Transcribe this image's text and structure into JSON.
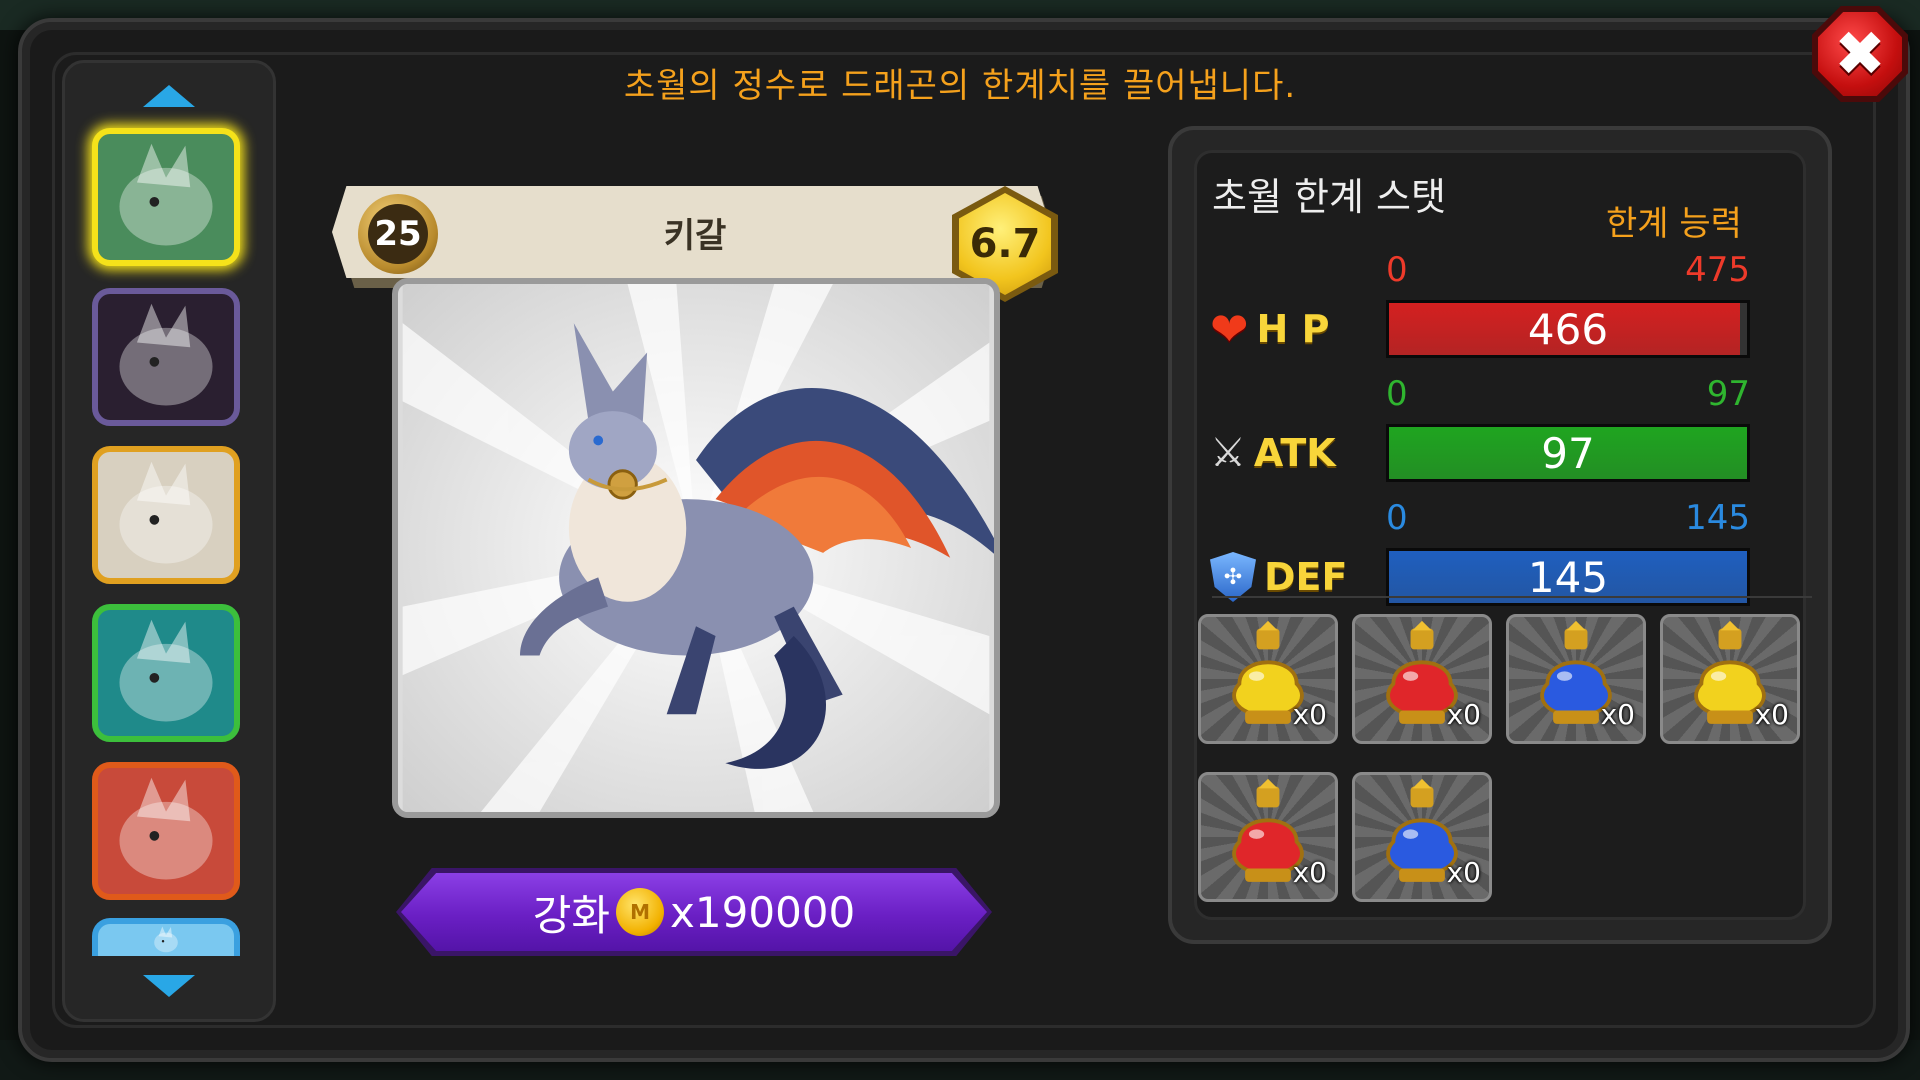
{
  "instruction": "초월의 정수로 드래곤의 한계치를 끌어냅니다.",
  "close_icon_glyph": "✖",
  "dragon_list": {
    "items": [
      {
        "name": "dragon-thumb-kigal",
        "border": "#f5e21a",
        "color": "#4a8c5c"
      },
      {
        "name": "dragon-thumb-dark",
        "border": "#6a5a9a",
        "color": "#2a1f30"
      },
      {
        "name": "dragon-thumb-white-gold",
        "border": "#e0a020",
        "color": "#d8d0c0"
      },
      {
        "name": "dragon-thumb-cyan",
        "border": "#3cbf3c",
        "color": "#1f8a8a"
      },
      {
        "name": "dragon-thumb-red",
        "border": "#e05a1a",
        "color": "#c84a3a"
      },
      {
        "name": "dragon-thumb-ice",
        "border": "#3aa0e0",
        "color": "#7ac8f0"
      }
    ]
  },
  "dragon": {
    "level": "25",
    "name": "키갈",
    "grade": "6.7"
  },
  "enhance": {
    "label": "강화",
    "coin_glyph": "M",
    "cost": "x190000"
  },
  "stats": {
    "title": "초월 한계 스탯",
    "limit_label": "한계 능력",
    "items": [
      {
        "label": "H P",
        "icon": "heart-icon",
        "glyph": "❤",
        "min": "0",
        "max": "475",
        "value": "466",
        "fill_fraction": 0.981,
        "color": "#d42020",
        "range_color": "#ee3a2a"
      },
      {
        "label": "ATK",
        "icon": "swords-icon",
        "glyph": "⚔",
        "min": "0",
        "max": "97",
        "value": "97",
        "fill_fraction": 1.0,
        "color": "#1fa520",
        "range_color": "#2fb52f"
      },
      {
        "label": "DEF",
        "icon": "shield-icon",
        "glyph": "✣",
        "min": "0",
        "max": "145",
        "value": "145",
        "fill_fraction": 1.0,
        "color": "#1f5fbf",
        "range_color": "#2a8ae0"
      }
    ]
  },
  "potions": [
    {
      "name": "potion-yellow-small",
      "color": "#f2d21e",
      "count": "x0"
    },
    {
      "name": "potion-red-small",
      "color": "#e0262a",
      "count": "x0"
    },
    {
      "name": "potion-blue-small",
      "color": "#2a5ae0",
      "count": "x0"
    },
    {
      "name": "potion-yellow-large",
      "color": "#f2d21e",
      "count": "x0"
    },
    {
      "name": "potion-red-large",
      "color": "#e0262a",
      "count": "x0"
    },
    {
      "name": "potion-blue-large",
      "color": "#2a5ae0",
      "count": "x0"
    }
  ]
}
